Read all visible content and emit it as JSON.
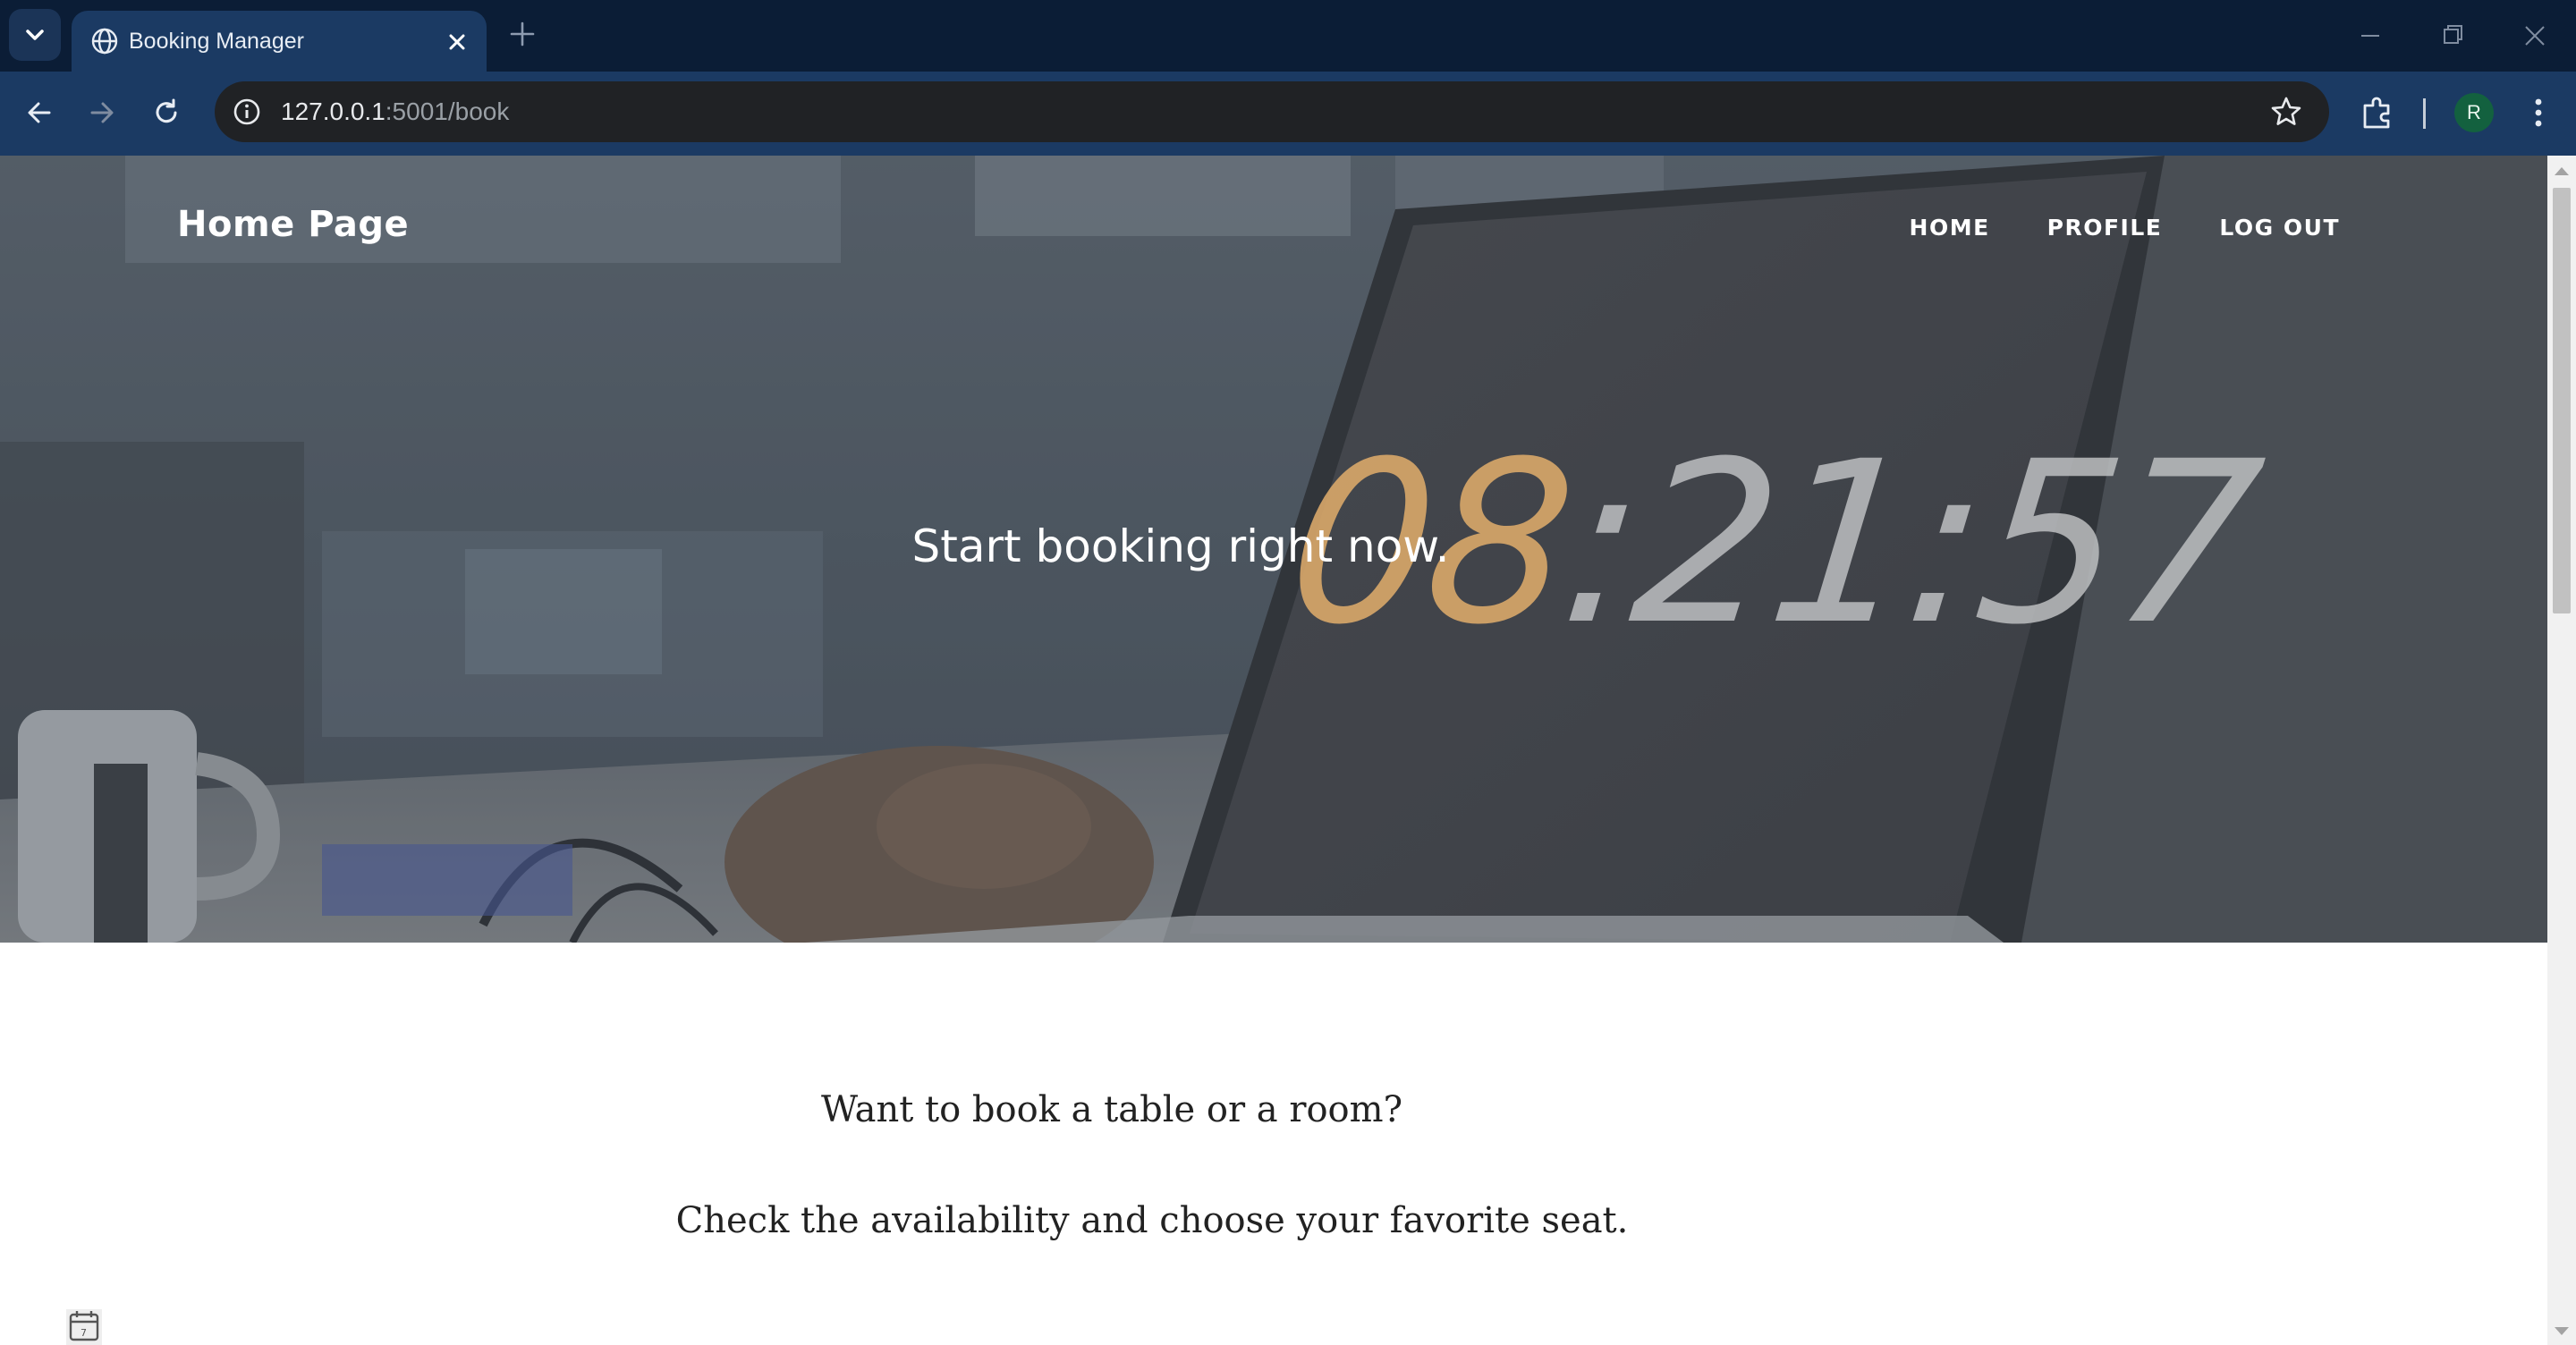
{
  "browser": {
    "tab_title": "Booking Manager",
    "url_host": "127.0.0.1",
    "url_path": ":5001/book",
    "profile_initial": "R",
    "icons": [
      "tab-search-icon",
      "globe-icon",
      "close-icon",
      "plus-icon",
      "minimize-icon",
      "restore-icon",
      "window-close-icon",
      "back-arrow-icon",
      "forward-arrow-icon",
      "reload-icon",
      "info-icon",
      "star-icon",
      "extensions-icon",
      "more-vert-icon"
    ]
  },
  "navbar": {
    "brand": "Home Page",
    "links": [
      "HOME",
      "PROFILE",
      "LOG OUT"
    ]
  },
  "hero": {
    "heading": "Start booking right now.",
    "clock_digits": "08:21:57"
  },
  "content": {
    "line1": "Want to book a table or a room?",
    "line2": "Check the availability and choose your favorite seat."
  },
  "colors": {
    "tabstrip": "#0b1d36",
    "toolbar": "#1b3a63",
    "omnibox": "#202225",
    "hero_overlay": "#4f5a66",
    "clock_orange": "#d9a86a",
    "clock_grey": "#bdbfc1"
  }
}
